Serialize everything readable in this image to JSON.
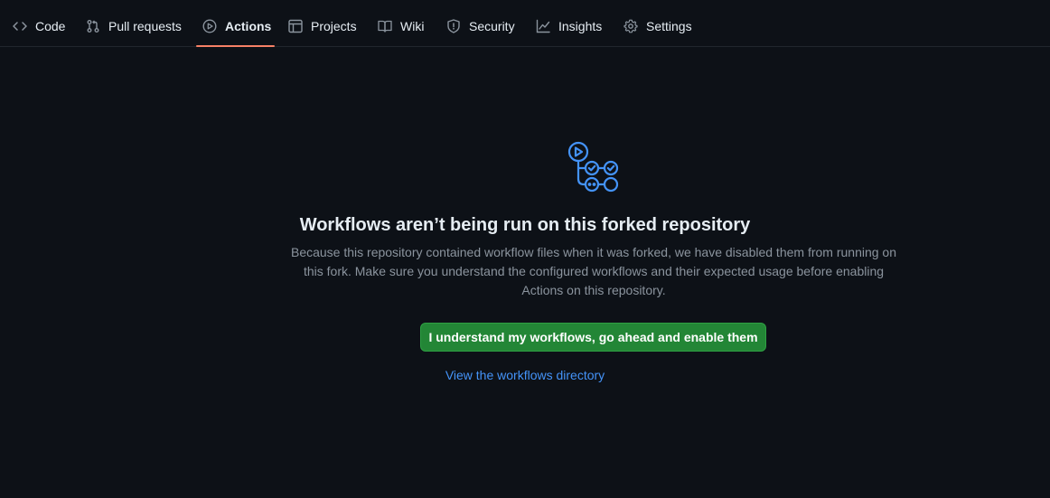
{
  "nav": {
    "tabs": [
      {
        "label": "Code",
        "icon": "code-icon"
      },
      {
        "label": "Pull requests",
        "icon": "git-pull-request-icon"
      },
      {
        "label": "Actions",
        "icon": "play-icon",
        "active": true
      },
      {
        "label": "Projects",
        "icon": "table-icon"
      },
      {
        "label": "Wiki",
        "icon": "book-icon"
      },
      {
        "label": "Security",
        "icon": "shield-icon"
      },
      {
        "label": "Insights",
        "icon": "graph-icon"
      },
      {
        "label": "Settings",
        "icon": "gear-icon"
      }
    ],
    "active_underline_color": "#f78166"
  },
  "main": {
    "icon": "workflow-icon",
    "title": "Workflows aren’t being run on this forked repository",
    "description": "Because this repository contained workflow files when it was forked, we have disabled them from running on this fork. Make sure you understand the configured workflows and their expected usage before enabling Actions on this repository.",
    "enable_button_label": "I understand my workflows, go ahead and enable them",
    "directory_link_label": "View the workflows directory"
  },
  "colors": {
    "background": "#0d1117",
    "text": "#e6edf3",
    "muted": "#8b949e",
    "accent_blue": "#4493f8",
    "button_green": "#238636"
  }
}
